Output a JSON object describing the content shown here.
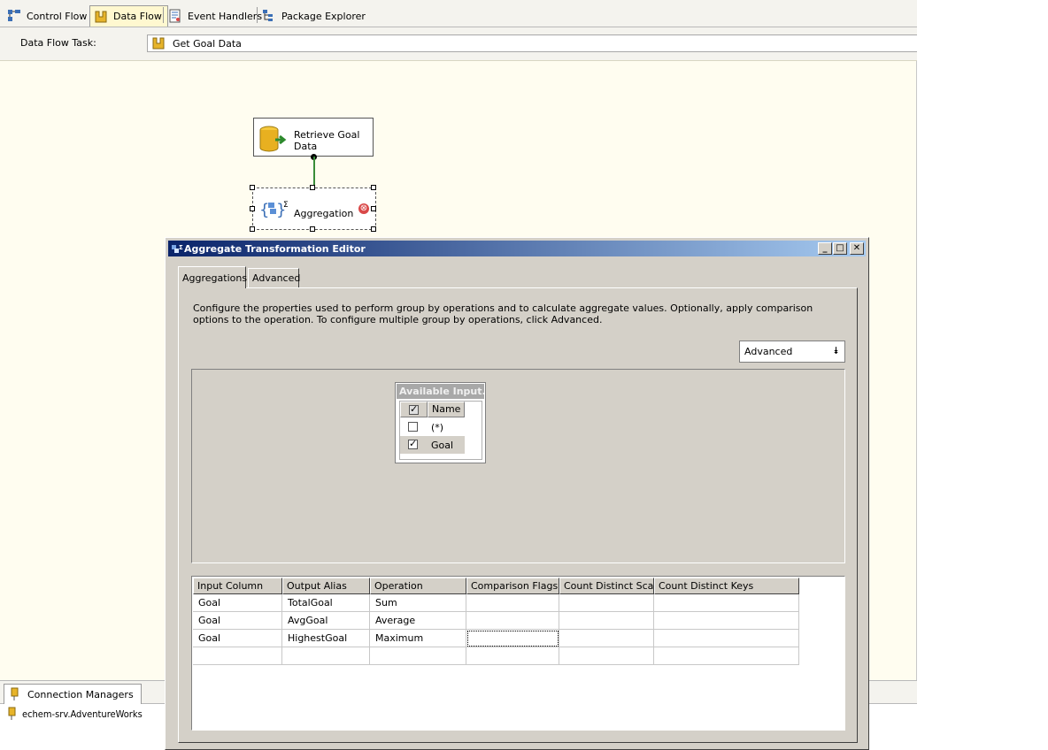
{
  "tabs": [
    {
      "label": "Control Flow",
      "icon": "control-flow-icon"
    },
    {
      "label": "Data Flow",
      "icon": "data-flow-icon",
      "active": true
    },
    {
      "label": "Event Handlers",
      "icon": "event-handlers-icon"
    },
    {
      "label": "Package Explorer",
      "icon": "package-explorer-icon"
    }
  ],
  "task_bar": {
    "label": "Data Flow Task:",
    "value": "Get Goal Data"
  },
  "canvas": {
    "source_node": {
      "label_line1": "Retrieve Goal",
      "label_line2": "Data"
    },
    "aggregate_node": {
      "label": "Aggregation",
      "error_glyph": "⊗"
    }
  },
  "connection_managers": {
    "tab_label": "Connection Managers",
    "items": [
      "echem-srv.AdventureWorks"
    ]
  },
  "dialog": {
    "title": "Aggregate Transformation Editor",
    "minimize_glyph": "_",
    "maximize_glyph": "□",
    "close_glyph": "✕",
    "tabs": [
      "Aggregations",
      "Advanced"
    ],
    "description": "Configure the properties used to perform group by operations and to calculate aggregate values. Optionally, apply comparison options to the operation. To configure multiple group by operations, click Advanced.",
    "advanced_button": "Advanced",
    "advanced_glyph": "⯯",
    "available_inputs": {
      "title": "Available Input...",
      "header": "Name",
      "rows": [
        {
          "name": "(*)",
          "checked": false
        },
        {
          "name": "Goal",
          "checked": true
        }
      ]
    },
    "grid": {
      "columns": [
        "Input Column",
        "Output Alias",
        "Operation",
        "Comparison Flags",
        "Count Distinct Scale",
        "Count Distinct Keys"
      ],
      "rows": [
        [
          "Goal",
          "TotalGoal",
          "Sum",
          "",
          "",
          ""
        ],
        [
          "Goal",
          "AvgGoal",
          "Average",
          "",
          "",
          ""
        ],
        [
          "Goal",
          "HighestGoal",
          "Maximum",
          "",
          "",
          ""
        ],
        [
          "",
          "",
          "",
          "",
          "",
          ""
        ]
      ]
    }
  },
  "colors": {
    "designer_bg": "#fffdf0",
    "dialog_bg": "#d4d0c8",
    "title_gradient_start": "#0a246a",
    "title_gradient_end": "#a6caf0",
    "selected_row": "#a9b3cc",
    "alt_row": "#fffde8"
  }
}
